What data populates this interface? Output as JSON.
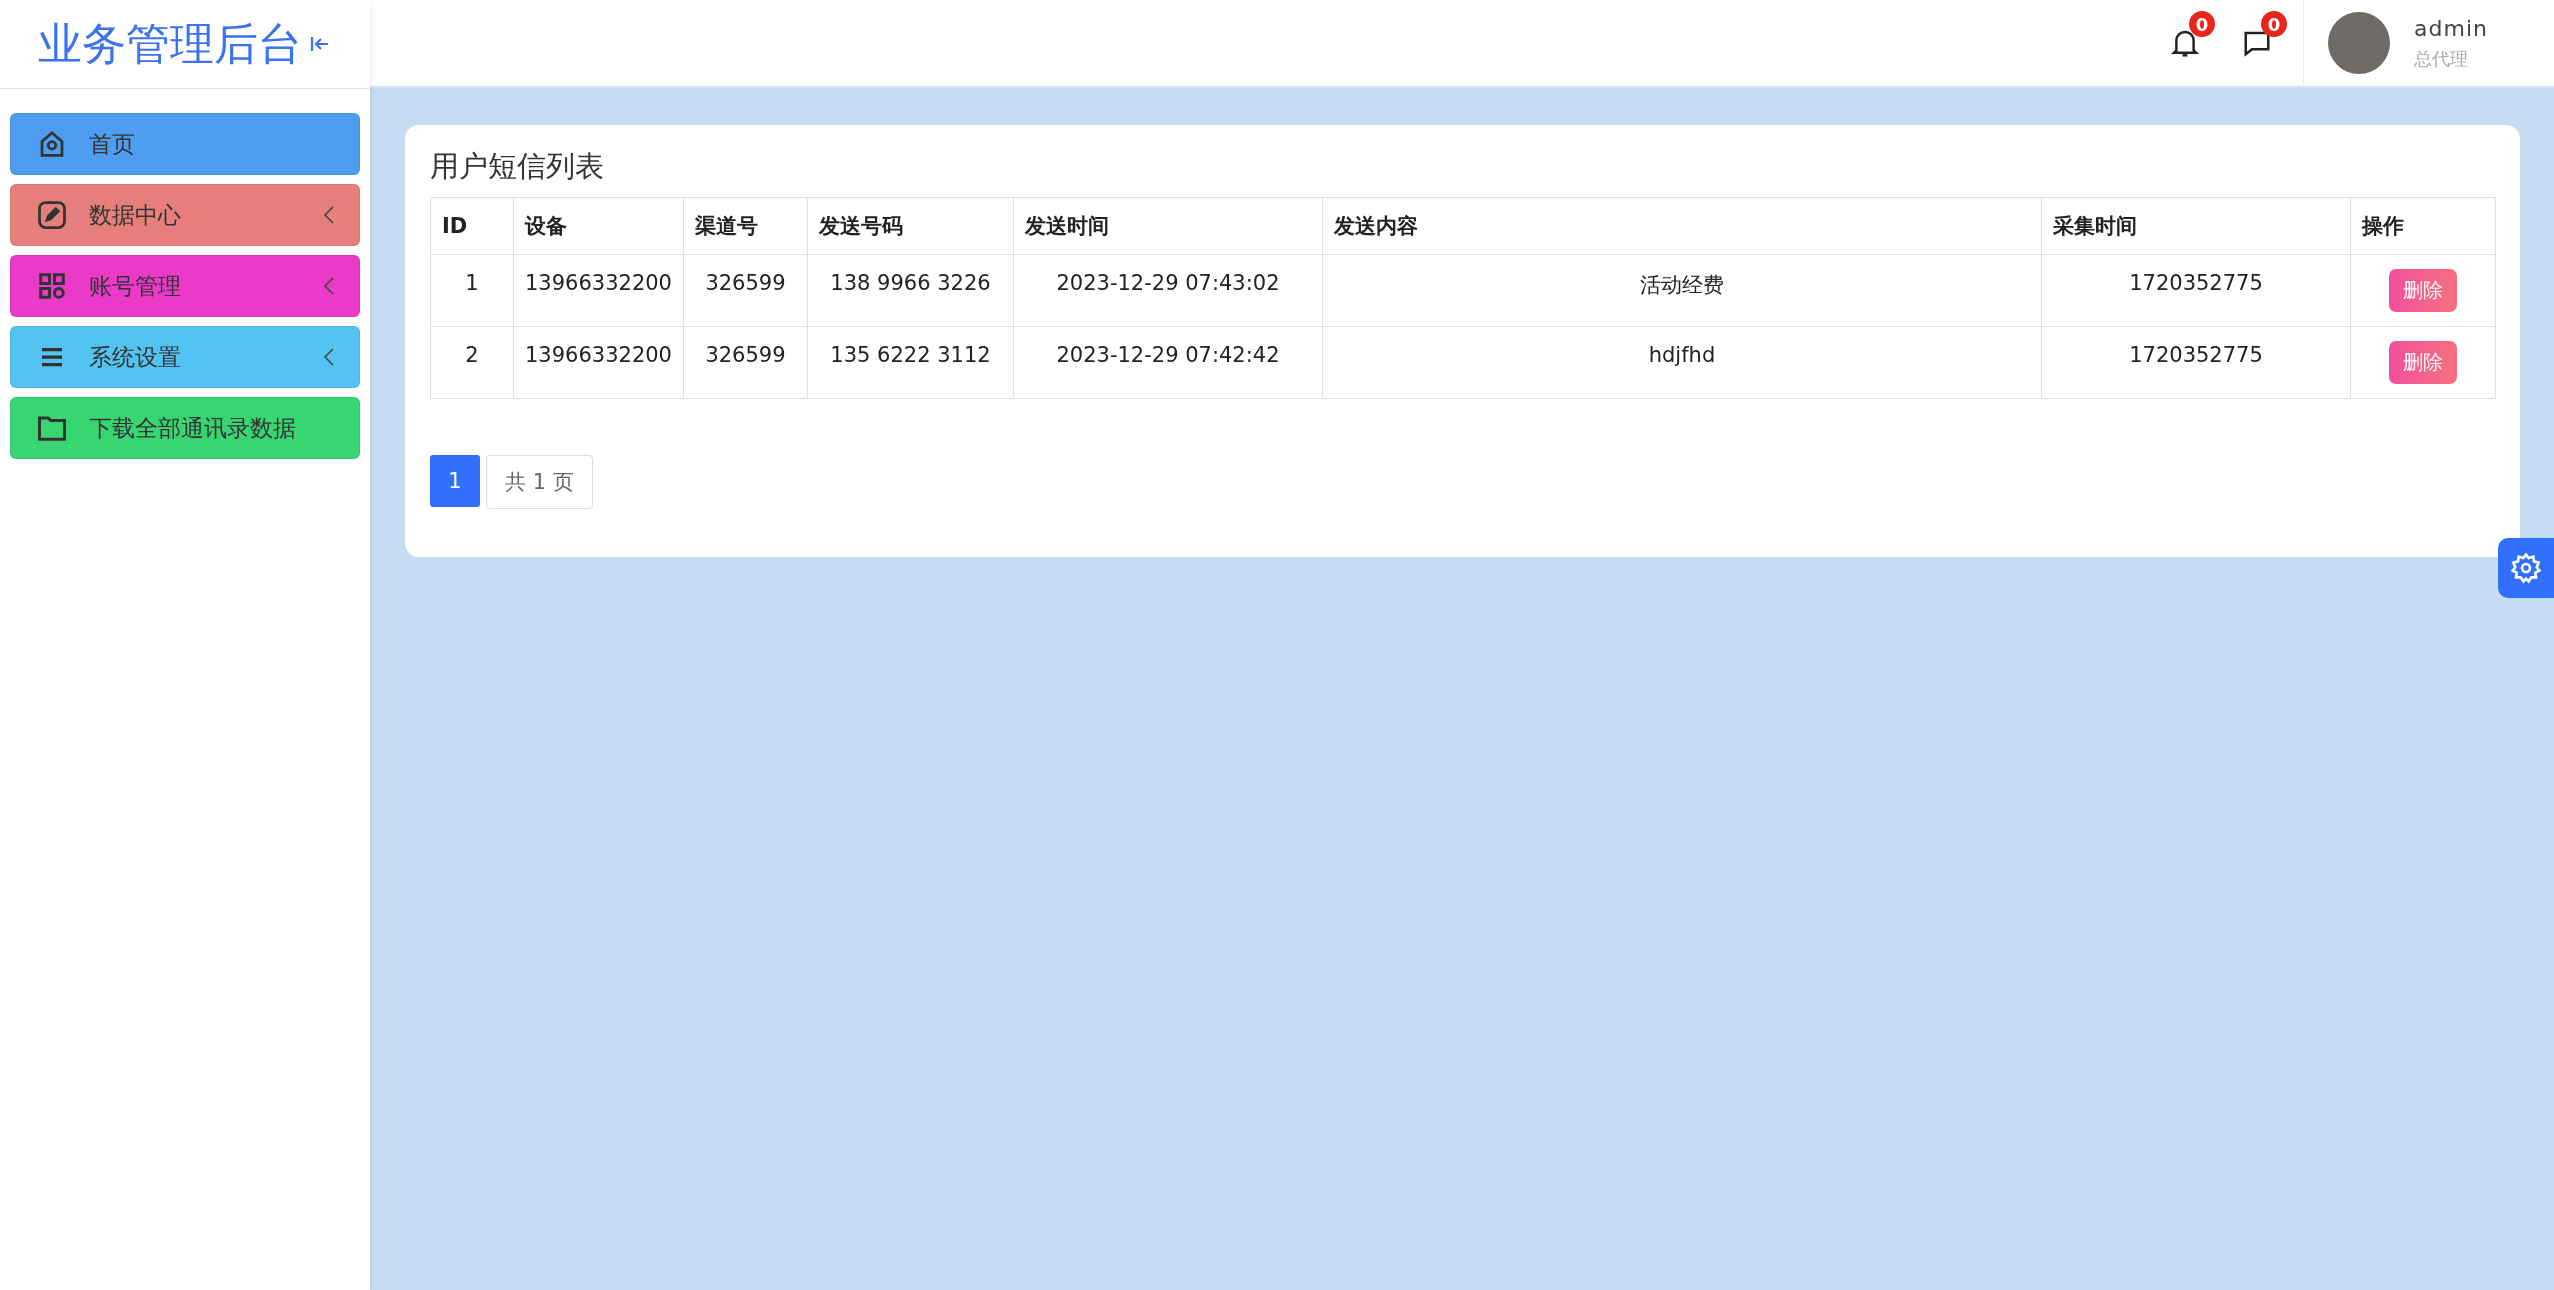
{
  "sidebar": {
    "title": "业务管理后台",
    "menu": [
      {
        "label": "首页",
        "kind": "home",
        "color": "#4f9df0",
        "expandable": false
      },
      {
        "label": "数据中心",
        "kind": "edit",
        "color": "#e67f7b",
        "expandable": true
      },
      {
        "label": "账号管理",
        "kind": "grid",
        "color": "#ec3ac8",
        "expandable": true
      },
      {
        "label": "系统设置",
        "kind": "menu",
        "color": "#53c3f1",
        "expandable": true
      },
      {
        "label": "下载全部通讯录数据",
        "kind": "folder",
        "color": "#38d673",
        "expandable": false
      }
    ]
  },
  "header": {
    "notifications": {
      "count": "0"
    },
    "messages": {
      "count": "0"
    },
    "user": {
      "name": "admin",
      "role": "总代理"
    }
  },
  "panel": {
    "title": "用户短信列表",
    "table": {
      "columns": [
        "ID",
        "设备",
        "渠道号",
        "发送号码",
        "发送时间",
        "发送内容",
        "采集时间",
        "操作"
      ],
      "rows": [
        {
          "cells": [
            "1",
            "13966332200",
            "326599",
            "138 9966 3226",
            "2023-12-29 07:43:02",
            "活动经费",
            "1720352775"
          ],
          "action": "删除"
        },
        {
          "cells": [
            "2",
            "13966332200",
            "326599",
            "135 6222 3112",
            "2023-12-29 07:42:42",
            "hdjfhd",
            "1720352775"
          ],
          "action": "删除"
        }
      ]
    },
    "pagination": {
      "pages": [
        {
          "label": "1",
          "selected": true
        }
      ],
      "summary": "共 1 页"
    }
  }
}
